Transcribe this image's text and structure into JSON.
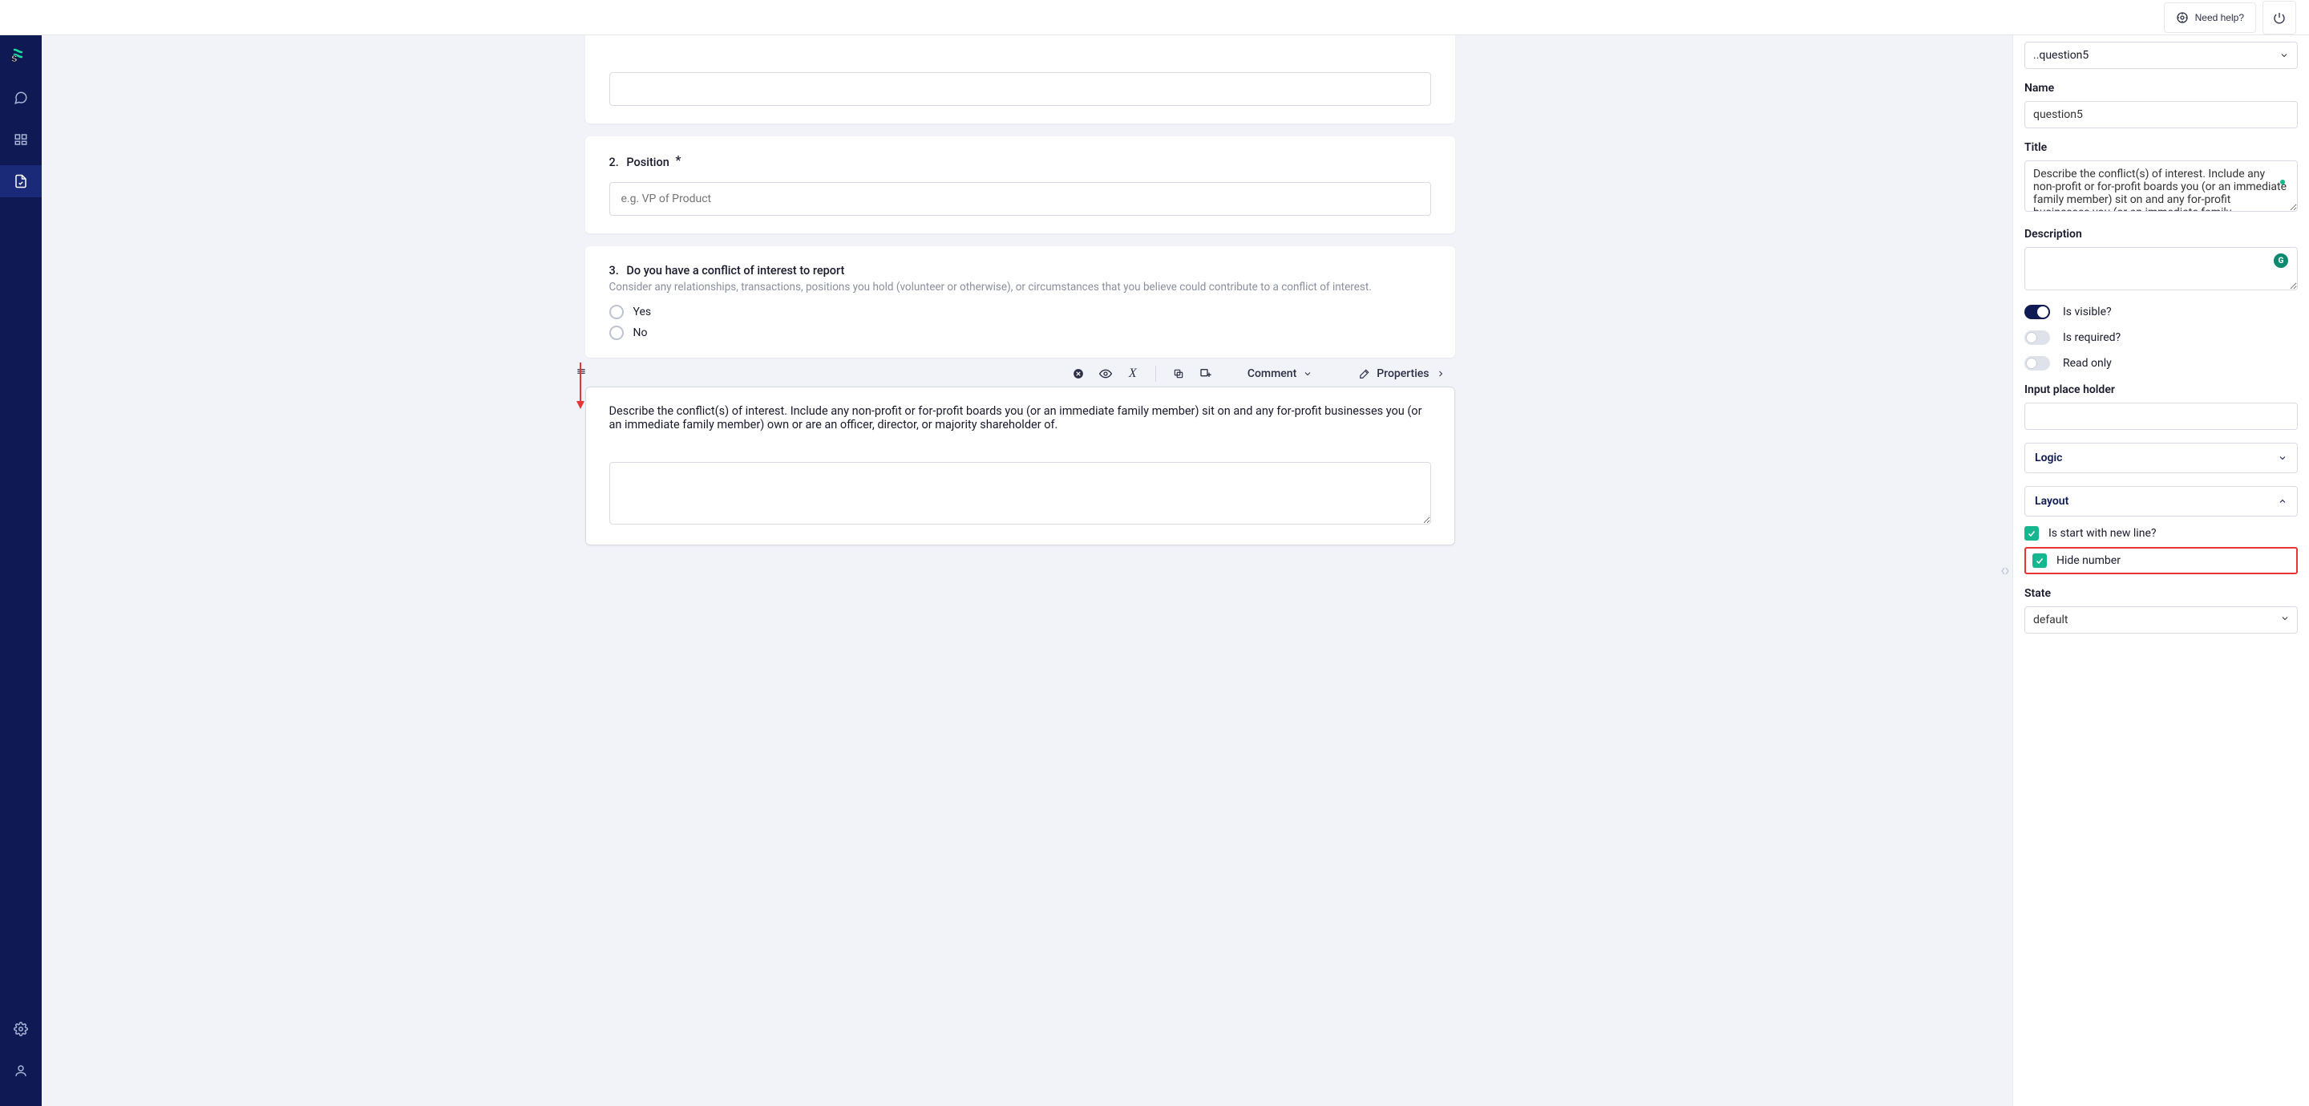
{
  "header": {
    "need_help": "Need help?"
  },
  "sidebar": {
    "items": [
      "chat",
      "modules",
      "builder"
    ]
  },
  "questions": {
    "q2": {
      "num": "2.",
      "title": "Position",
      "placeholder": "e.g. VP of Product"
    },
    "q3": {
      "num": "3.",
      "title": "Do you have a conflict of interest to report",
      "desc": "Consider any relationships, transactions, positions you hold (volunteer or otherwise), or circumstances that you believe could contribute to a conflict of interest.",
      "options": {
        "yes": "Yes",
        "no": "No"
      }
    },
    "q5": {
      "title": "Describe the conflict(s) of interest. Include any non-profit or for-profit boards you (or an immediate family member) sit on and any for-profit businesses you (or an immediate family member) own or are an officer, director, or majority shareholder of."
    }
  },
  "toolbar": {
    "comment": "Comment",
    "properties": "Properties"
  },
  "props": {
    "path": "..question5",
    "name_label": "Name",
    "name_value": "question5",
    "title_label": "Title",
    "title_value": "Describe the conflict(s) of interest. Include any non-profit or for-profit boards you (or an immediate family member) sit on and any for-profit businesses you (or an immediate family ",
    "description_label": "Description",
    "is_visible": "Is visible?",
    "is_required": "Is required?",
    "read_only": "Read only",
    "placeholder_label": "Input place holder",
    "logic": "Logic",
    "layout": "Layout",
    "start_new_line": "Is start with new line?",
    "hide_number": "Hide number",
    "state_label": "State",
    "state_value": "default"
  }
}
